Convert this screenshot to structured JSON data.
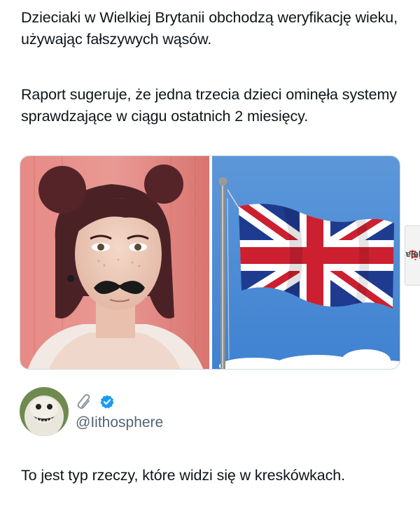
{
  "post": {
    "paragraph_1": "Dzieciaki w Wielkiej Brytanii obchodzą weryfikację wieku, używając fałszywych wąsów.",
    "paragraph_2": "Raport sugeruje, że jedna trzecia dzieci ominęła systemy sprawdzające w ciągu ostatnich 2 miesięcy."
  },
  "media": {
    "left_image": "girl-with-fake-mustache-photo",
    "right_image": "union-jack-flag-photo"
  },
  "watermark": {
    "brand": "jeja",
    "suffix": ".pl"
  },
  "reply": {
    "handle": "@Iithosphere",
    "text": "To jest typ rzeczy, które widzi się w kreskówkach.",
    "icons": [
      "paperclip-icon",
      "verified-badge-icon"
    ],
    "verified_color": "#1d9bf0"
  },
  "colors": {
    "text": "#0f1419",
    "secondary_text": "#536471",
    "accent": "#1d9bf0"
  }
}
